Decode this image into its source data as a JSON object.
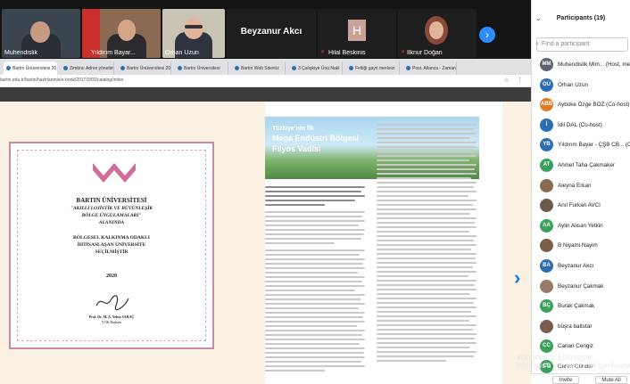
{
  "gallery": {
    "tiles": [
      {
        "name": "Muhendislik"
      },
      {
        "name": "Yıldırım Bayar..."
      },
      {
        "name": "Orhan Uzun"
      },
      {
        "name": "Beyzanur Akcı"
      },
      {
        "name": "Hilal Beskinis"
      },
      {
        "name": "İlknur Doğan"
      }
    ],
    "tile_4_initial": "H",
    "next_icon": "chevron-right-icon"
  },
  "browser": {
    "tabs": [
      "Bartın Ünüversitesi 20",
      "Zimbra: Adres yönetim",
      "Bartın Ünüversitesi 20",
      "Bartın Üniversitesi",
      "Bartın Web Sitemiz",
      "3 Çalışkiye Ünü Nakl",
      "Feltiği gayri merkezi ",
      "Post. Allanza - Zaman "
    ],
    "url": "bartin.edu.tr/bartin/hazirlanmis/e-book/2017/2/03/catalog/index",
    "menu_icons": "☆ ⋮"
  },
  "slide": {
    "cert_univ": "BARTIN ÜNİVERSİTESİ",
    "cert_q1": "\"AKILLI LOJİSTİK VE BÜTÜNLEŞİK",
    "cert_q2": "BÖLGE UYGULAMALARI\"",
    "cert_q3": "ALANINDA",
    "cert_f1": "BÖLGESEL KALKINMA ODAKLI",
    "cert_f2": "İHTİSASLAŞAN ÜNİVERSİTE",
    "cert_f3": "SEÇİLMİŞTİR",
    "cert_year": "2020",
    "cert_sig1": "Prof. Dr. M. A. Yekta SARAÇ",
    "cert_sig2": "YÖK Başkanı",
    "banner_l1": "Türkiye'nin İlk",
    "banner_l2": "Mega Endüstri Bölgesi",
    "banner_l3": "Filyos Vadisi"
  },
  "participants": {
    "title": "Participants (19)",
    "search_placeholder": "Find a participant",
    "people": [
      {
        "initials": "MM",
        "name": "Muhendislik Mim... (Host, me)",
        "color": "#5b6470"
      },
      {
        "initials": "OU",
        "name": "Orhan Uzun",
        "color": "#2d6db5"
      },
      {
        "initials": "ABB",
        "name": "Aybüke Özge BOZ (Co-host)",
        "color": "#e07b25"
      },
      {
        "initials": "İ",
        "name": "İdil DAL (Co-host)",
        "color": "#2d6db5"
      },
      {
        "initials": "YB",
        "name": "Yıldırım Bayar - ÇŞB CB... (Co-host)",
        "color": "#2d6db5"
      },
      {
        "initials": "AT",
        "name": "Ahmet Taha Çakmaker",
        "color": "#3aa05b"
      },
      {
        "initials": "",
        "name": "Aleyna Erkan",
        "color": "#8a6a4f"
      },
      {
        "initials": "",
        "name": "Anıl Furkan AVCI",
        "color": "#6a5a4a"
      },
      {
        "initials": "AA",
        "name": "Aylin Alisan Yetkin",
        "color": "#3aa05b"
      },
      {
        "initials": "",
        "name": "B Niyami Nayim",
        "color": "#7a5e48"
      },
      {
        "initials": "BA",
        "name": "Beyzanur Akcı",
        "color": "#2d6db5"
      },
      {
        "initials": "",
        "name": "Beyzanur Çakmak",
        "color": "#9b7a6a"
      },
      {
        "initials": "BÇ",
        "name": "Burak Çakmak",
        "color": "#3aa05b"
      },
      {
        "initials": "",
        "name": "büşra baltutar",
        "color": "#7b5a50"
      },
      {
        "initials": "CC",
        "name": "Canan Cengiz",
        "color": "#3aa05b"
      },
      {
        "initials": "CD",
        "name": "Ceren Dündar",
        "color": "#3aa05b"
      }
    ],
    "invite": "Invite",
    "mute_all": "Mute All"
  },
  "watermark": {
    "l1": "Windows'u Etkinleştir",
    "l2": "Windows'u etkinleştirmek için Ayarlar'a gidin."
  }
}
